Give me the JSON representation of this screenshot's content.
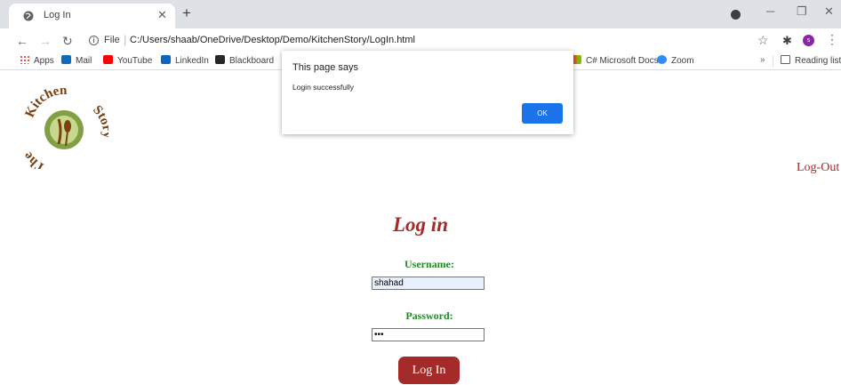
{
  "browser": {
    "tab_title": "Log In",
    "url_scheme": "File",
    "url_path": "C:/Users/shaab/OneDrive/Desktop/Demo/KitchenStory/LogIn.html",
    "profile_initial": "s",
    "bookmarks": [
      {
        "label": "Apps",
        "icon": "apps-grid-icon",
        "color": "#ea4335"
      },
      {
        "label": "Mail",
        "icon": "outlook-icon",
        "color": "#0f6cbd"
      },
      {
        "label": "YouTube",
        "icon": "youtube-icon",
        "color": "#ff0000"
      },
      {
        "label": "LinkedIn",
        "icon": "linkedin-icon",
        "color": "#0a66c2"
      },
      {
        "label": "Blackboard",
        "icon": "blackboard-icon",
        "color": "#262626"
      },
      {
        "label": "C# Microsoft Docs",
        "icon": "microsoft-docs-icon",
        "color": "#f25022"
      },
      {
        "label": "Zoom",
        "icon": "zoom-icon",
        "color": "#2d8cff"
      }
    ],
    "reading_list": "Reading list",
    "more_bookmarks": "»"
  },
  "page": {
    "logo_text_top": "Kitchen",
    "logo_text_left": "The",
    "logo_text_right": "Story",
    "logout": "Log-Out",
    "title": "Log in",
    "username_label": "Username:",
    "username_value": "shahad",
    "password_label": "Password:",
    "password_value": "•••",
    "login_button": "Log In",
    "accent_color": "#a52a2a",
    "label_color": "#228b22"
  },
  "dialog": {
    "title": "This page says",
    "message": "Login successfully",
    "ok": "OK"
  }
}
